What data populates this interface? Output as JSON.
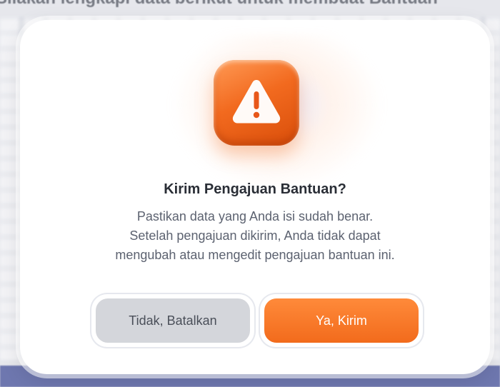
{
  "background": {
    "heading_partial": "Silakan lengkapi data berikut untuk membuat Bantuan"
  },
  "dialog": {
    "icon": "warning-triangle-icon",
    "accent_color": "#f26b1c",
    "title": "Kirim Pengajuan Bantuan?",
    "message_lines": [
      "Pastikan data yang Anda isi sudah benar.",
      "Setelah pengajuan dikirim, Anda tidak dapat",
      "mengubah atau mengedit pengajuan bantuan ini."
    ],
    "cancel_label": "Tidak, Batalkan",
    "confirm_label": "Ya, Kirim"
  }
}
